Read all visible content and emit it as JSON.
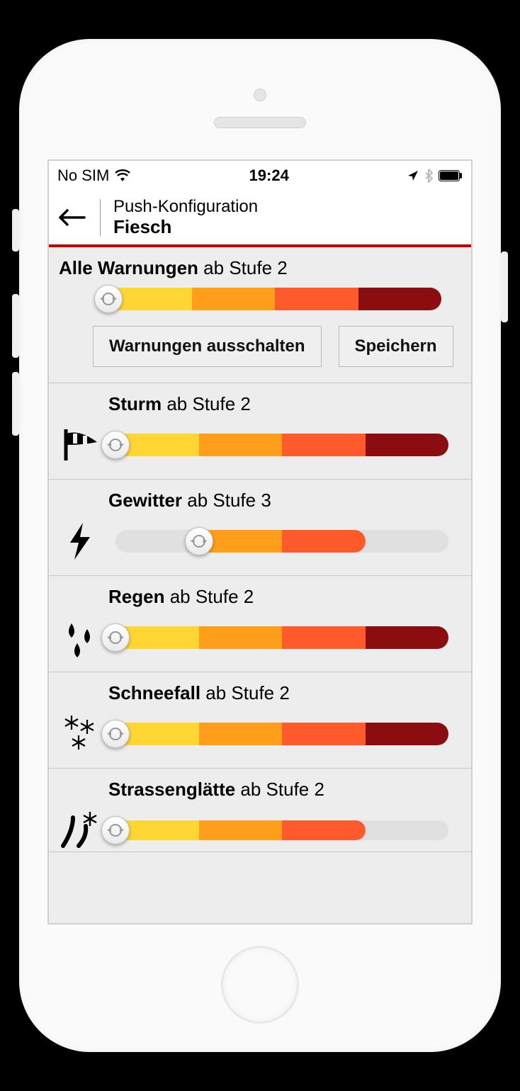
{
  "status": {
    "carrier": "No SIM",
    "time": "19:24"
  },
  "nav": {
    "title": "Push-Konfiguration",
    "location": "Fiesch"
  },
  "levels": {
    "label_prefix": "ab Stufe",
    "colors": {
      "2": "#ffd633",
      "3": "#ff9e1a",
      "4": "#ff5a2c",
      "5": "#8c0d10"
    }
  },
  "main": {
    "title": "Alle Warnungen",
    "level": 2,
    "max_level": 5,
    "buttons": {
      "disable": "Warnungen ausschalten",
      "save": "Speichern"
    }
  },
  "warnings": [
    {
      "id": "sturm",
      "title": "Sturm",
      "level": 2,
      "max_level": 5,
      "icon": "windsock-icon"
    },
    {
      "id": "gewitter",
      "title": "Gewitter",
      "level": 3,
      "max_level": 4,
      "icon": "lightning-icon"
    },
    {
      "id": "regen",
      "title": "Regen",
      "level": 2,
      "max_level": 5,
      "icon": "raindrops-icon"
    },
    {
      "id": "schneefall",
      "title": "Schneefall",
      "level": 2,
      "max_level": 5,
      "icon": "snowflakes-icon"
    },
    {
      "id": "strassenglaette",
      "title": "Strassenglätte",
      "level": 2,
      "max_level": 4,
      "icon": "road-ice-icon"
    }
  ]
}
